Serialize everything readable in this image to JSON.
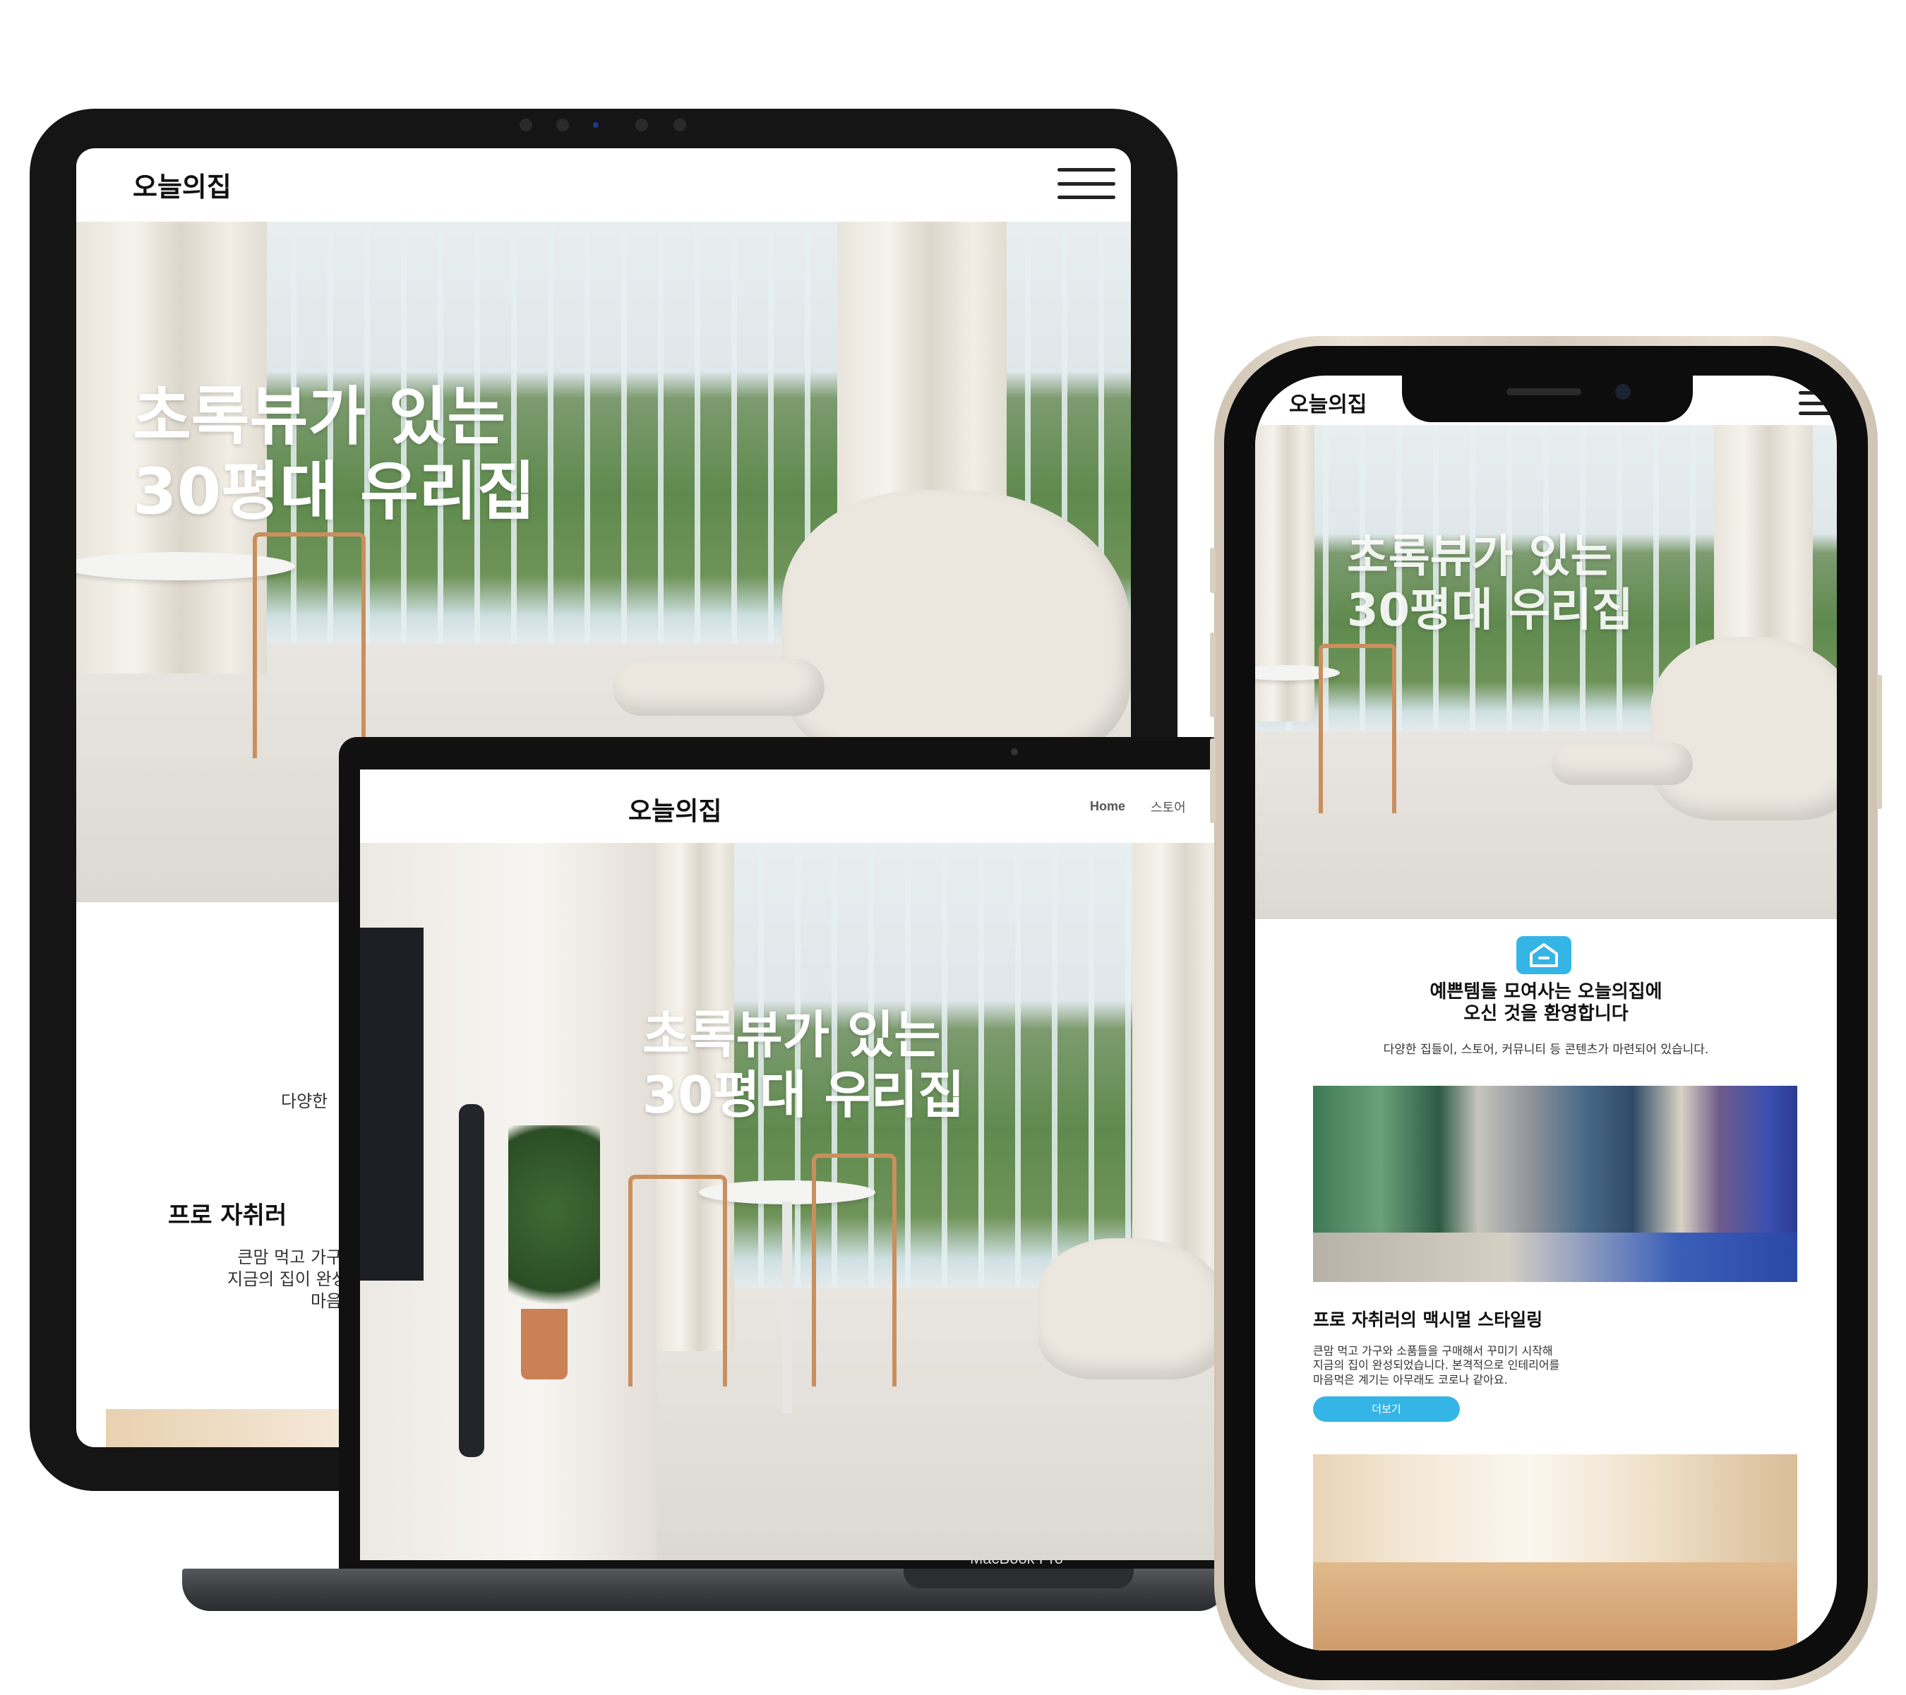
{
  "brand": {
    "logo": "오늘의집"
  },
  "hero": {
    "line1": "초록뷰가 있는",
    "line2": "30평대 우리집"
  },
  "laptop": {
    "nav": {
      "home": "Home",
      "store": "스토어"
    },
    "label": "MacBook Pro"
  },
  "tablet": {
    "visible_sub_fragment": "다양한",
    "card_title_fragment": "프로 자취러",
    "desc_fragment_lines": [
      "큰맘 먹고 가구와 소품",
      "지금의 집이 완성되었습",
      "마음먹은 계"
    ]
  },
  "phone": {
    "welcome": {
      "title_line1": "예쁜템들 모여사는 오늘의집에",
      "title_line2": "오신 것을 환영합니다",
      "subtitle": "다양한 집들이, 스토어, 커뮤니티 등 콘텐츠가 마련되어 있습니다.",
      "icon": "house-icon"
    },
    "card": {
      "title": "프로 자취러의 맥시멀 스타일링",
      "desc_lines": [
        "큰맘 먹고 가구와 소품들을 구매해서 꾸미기 시작해",
        "지금의 집이 완성되었습니다. 본격적으로 인테리어를",
        "마음먹은 계기는 아무래도 코로나 같아요."
      ],
      "button": "더보기"
    }
  },
  "colors": {
    "accent": "#35b5e5",
    "text": "#111111",
    "device_dark": "#151515"
  }
}
